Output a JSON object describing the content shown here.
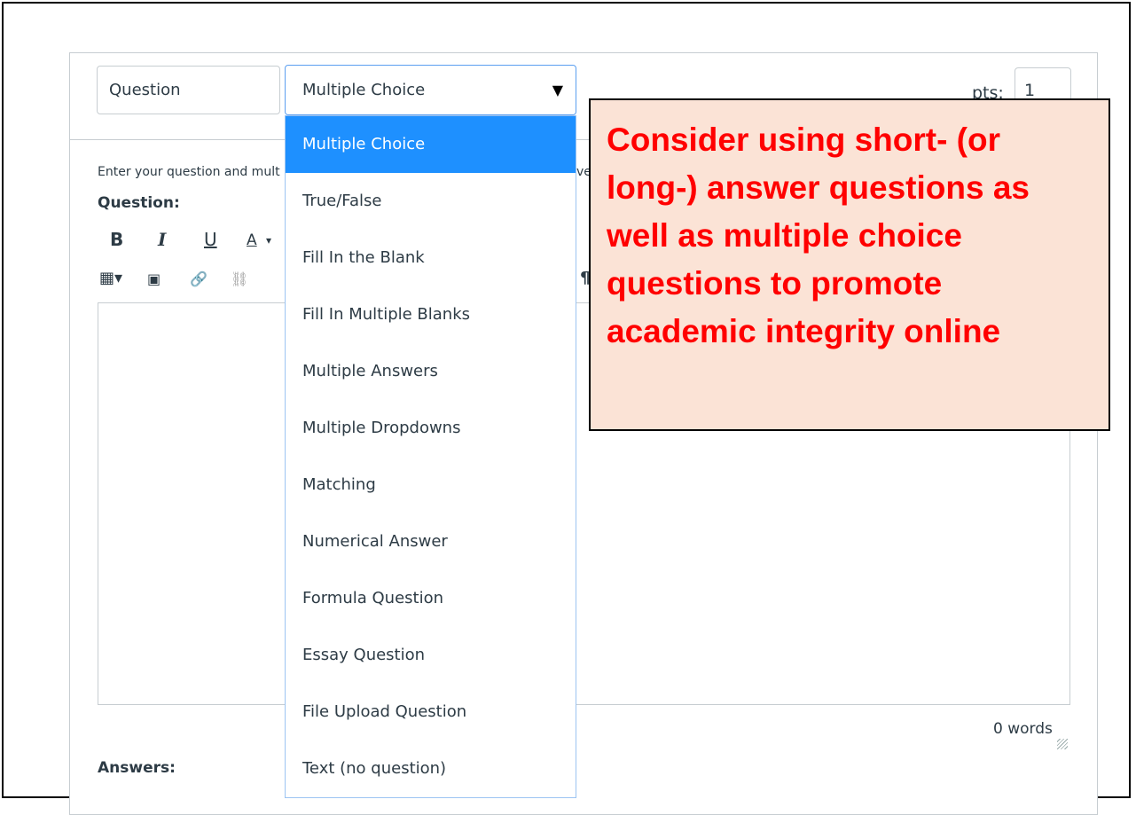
{
  "question_name": "Question",
  "question_type": {
    "selected": "Multiple Choice",
    "options": [
      "Multiple Choice",
      "True/False",
      "Fill In the Blank",
      "Fill In Multiple Blanks",
      "Multiple Answers",
      "Multiple Dropdowns",
      "Matching",
      "Numerical Answer",
      "Formula Question",
      "Essay Question",
      "File Upload Question",
      "Text (no question)"
    ]
  },
  "points": {
    "label": "pts:",
    "value": "1"
  },
  "instructions": "Enter your question and mult",
  "instructions_tail": "ve",
  "question_heading": "Question:",
  "toolbar": {
    "bold": "B",
    "italic": "I",
    "underline": "U",
    "font_color": "A",
    "table": "▦▾",
    "media": "▣",
    "link": "🔗",
    "unlink": "⛓",
    "pilcrow": "¶"
  },
  "word_count": "0 words",
  "answers_heading": "Answers:",
  "callout": {
    "text": "Consider using short- (or long-) answer questions as well as multiple choice questions to promote academic integrity online",
    "color": "#ff0000",
    "background": "#fbe3d6"
  },
  "colors": {
    "accent": "#1e90ff",
    "text": "#2d3b45",
    "border": "#c7cdd1"
  }
}
